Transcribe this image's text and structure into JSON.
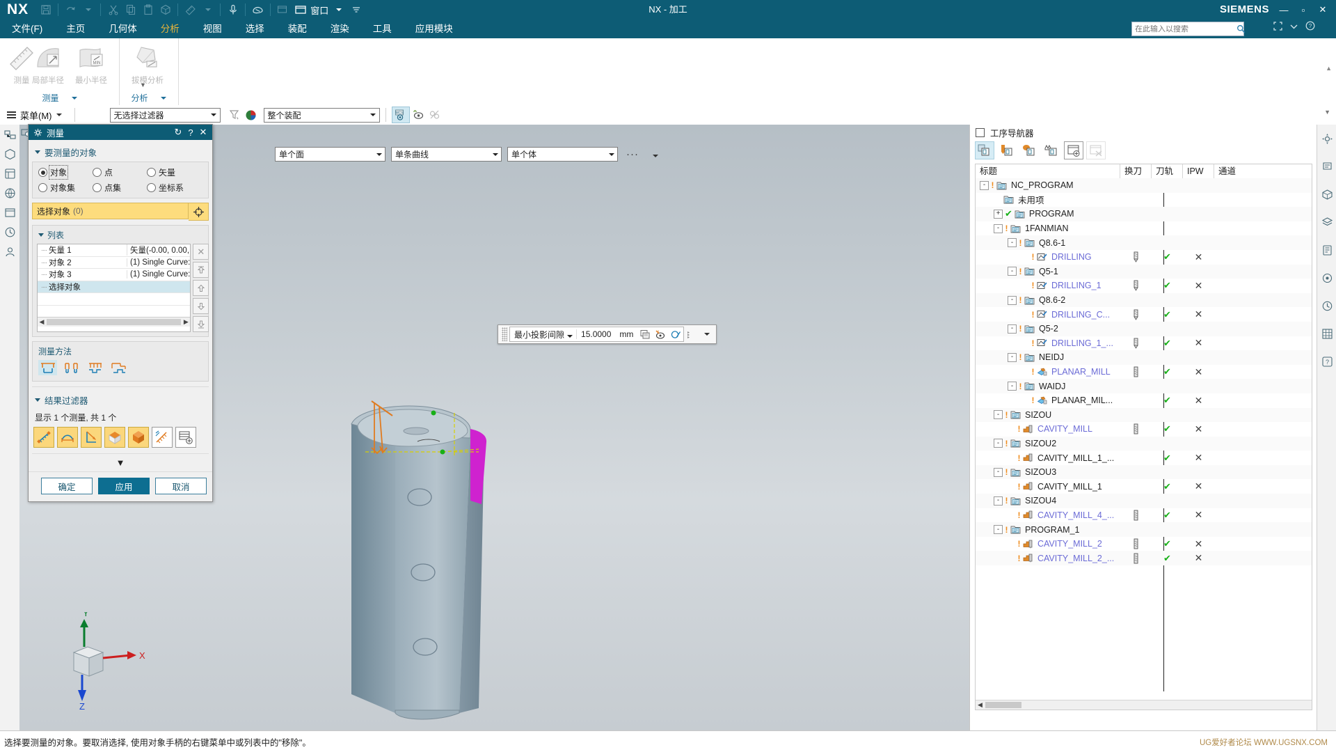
{
  "titlebar": {
    "logo": "NX",
    "window_title": "NX - 加工",
    "brand": "SIEMENS",
    "qat": [
      {
        "name": "save-icon",
        "label": "保存"
      },
      {
        "name": "undo-icon",
        "label": "撤销"
      },
      {
        "name": "undo-dropdown-icon",
        "label": "撤销下拉"
      },
      {
        "name": "cut-icon",
        "label": "剪切"
      },
      {
        "name": "copy-icon",
        "label": "复制"
      },
      {
        "name": "paste-icon",
        "label": "粘贴"
      },
      {
        "name": "paste-special-icon",
        "label": "选择性粘贴"
      },
      {
        "name": "measure-icon",
        "label": "测量"
      },
      {
        "name": "measure-dropdown-icon",
        "label": "测量下拉"
      },
      {
        "name": "microphone-icon",
        "label": "语音"
      },
      {
        "name": "eraser-icon",
        "label": "橡皮"
      },
      {
        "name": "window-list-icon",
        "label": "窗口列表"
      }
    ],
    "window_menu": "窗口",
    "win_buttons": [
      "—",
      "▫",
      "✕"
    ]
  },
  "ribbon": {
    "tabs": [
      {
        "label": "文件(F)",
        "active": false
      },
      {
        "label": "主页",
        "active": false
      },
      {
        "label": "几何体",
        "active": false
      },
      {
        "label": "分析",
        "active": true
      },
      {
        "label": "视图",
        "active": false
      },
      {
        "label": "选择",
        "active": false
      },
      {
        "label": "装配",
        "active": false
      },
      {
        "label": "渲染",
        "active": false
      },
      {
        "label": "工具",
        "active": false
      },
      {
        "label": "应用模块",
        "active": false
      }
    ],
    "search_placeholder": "在此输入以搜索",
    "groups": [
      {
        "label": "测量",
        "buttons": [
          {
            "label": "测量",
            "icon": "ruler-icon"
          },
          {
            "label": "局部半径",
            "icon": "local-radius-icon"
          },
          {
            "label": "最小半径",
            "icon": "min-radius-icon"
          }
        ]
      },
      {
        "label": "分析",
        "buttons": [
          {
            "label": "拔模分析",
            "icon": "draft-analysis-icon"
          }
        ]
      }
    ]
  },
  "selection_bar": {
    "menu_label": "菜单(M)",
    "filter_value": "无选择过滤器",
    "scope_value": "整个装配",
    "icons": [
      {
        "name": "selection-filter-icon",
        "active": false
      },
      {
        "name": "color-wheel-icon",
        "active": false
      },
      {
        "name": "wcs-display-icon",
        "active": true
      },
      {
        "name": "show-hide-icon",
        "active": false
      },
      {
        "name": "hide-icon",
        "active": false
      }
    ]
  },
  "left_bar": {
    "find_command": "发现命令",
    "items": [
      "assembly-navigator-icon",
      "part-navigator-icon",
      "reuse-library-icon",
      "hd3d-icon",
      "web-browser-icon",
      "history-icon",
      "roles-icon"
    ]
  },
  "graphics": {
    "selector_1": "单个面",
    "selector_2": "单条曲线",
    "selector_3": "单个体",
    "overflow": "···",
    "measure_float": {
      "mode": "最小投影间隙",
      "value": "15.0000",
      "unit": "mm",
      "icons": [
        "copy-result-icon",
        "annotation-icon",
        "circle-slash-icon",
        "list-options-icon"
      ]
    },
    "triad": {
      "x": "X",
      "y": "Y",
      "z": "Z"
    }
  },
  "dialog": {
    "title": "测量",
    "titlebar_icons": [
      "gear-icon",
      "reset-icon",
      "help-icon",
      "close-icon"
    ],
    "section_objects": "要测量的对象",
    "radios": [
      {
        "label": "对象",
        "checked": true,
        "focused": true
      },
      {
        "label": "点",
        "checked": false,
        "focused": false
      },
      {
        "label": "矢量",
        "checked": false,
        "focused": false
      },
      {
        "label": "对象集",
        "checked": false,
        "focused": false
      },
      {
        "label": "点集",
        "checked": false,
        "focused": false
      },
      {
        "label": "坐标系",
        "checked": false,
        "focused": false
      }
    ],
    "select_object_label": "选择对象",
    "select_object_count": "(0)",
    "list_label": "列表",
    "list_rows": [
      {
        "name": "矢量 1",
        "value": "矢量(-0.00, 0.00,",
        "selected": false
      },
      {
        "name": "对象 2",
        "value": "(1) Single Curve:",
        "selected": false
      },
      {
        "name": "对象 3",
        "value": "(1) Single Curve:",
        "selected": false
      },
      {
        "name": "选择对象",
        "value": "",
        "selected": true
      },
      {
        "name": "",
        "value": "",
        "selected": false
      },
      {
        "name": "",
        "value": "",
        "selected": false
      }
    ],
    "list_side_buttons": [
      "delete-icon",
      "move-to-top-icon",
      "move-up-icon",
      "move-down-icon",
      "move-to-bottom-icon"
    ],
    "method_label": "测量方法",
    "method_icons": [
      "measure-outer-icon",
      "measure-inner-icon",
      "measure-comb-icon",
      "measure-step-icon"
    ],
    "results_filter_label": "结果过滤器",
    "results_count_text": "显示 1 个测量, 共 1 个",
    "filter_icons": [
      "distance-filter-icon",
      "arc-filter-icon",
      "angle-filter-icon",
      "face-filter-icon",
      "body-filter-icon",
      "ruler-filter-icon",
      "table-add-icon"
    ],
    "buttons": {
      "ok": "确定",
      "apply": "应用",
      "cancel": "取消"
    }
  },
  "navigator": {
    "title": "工序导航器",
    "toolbar": [
      {
        "name": "program-order-view-icon",
        "active": true,
        "dim": false
      },
      {
        "name": "machine-tool-view-icon",
        "active": false,
        "dim": false
      },
      {
        "name": "geometry-view-icon",
        "active": false,
        "dim": false
      },
      {
        "name": "machining-method-view-icon",
        "active": false,
        "dim": false
      },
      {
        "name": "create-window-icon",
        "active": false,
        "dim": false
      },
      {
        "name": "close-window-icon",
        "active": false,
        "dim": true
      }
    ],
    "columns": [
      "标题",
      "换刀",
      "刀轨",
      "IPW",
      "通道"
    ],
    "rows": [
      {
        "name": "NC_PROGRAM",
        "indent": 0,
        "expander": "-",
        "bang": true,
        "check": false,
        "icon": "folder-icon",
        "blue": false,
        "tool": "",
        "path": "",
        "ipw": ""
      },
      {
        "name": "未用项",
        "indent": 1,
        "expander": "",
        "bang": false,
        "check": false,
        "icon": "folder-icon",
        "blue": false,
        "tool": "",
        "path": "",
        "ipw": ""
      },
      {
        "name": "PROGRAM",
        "indent": 1,
        "expander": "+",
        "bang": false,
        "check": true,
        "icon": "folder-icon",
        "blue": false,
        "tool": "",
        "path": "",
        "ipw": ""
      },
      {
        "name": "1FANMIAN",
        "indent": 1,
        "expander": "-",
        "bang": true,
        "check": false,
        "icon": "folder-icon",
        "blue": false,
        "tool": "",
        "path": "",
        "ipw": ""
      },
      {
        "name": "Q8.6-1",
        "indent": 2,
        "expander": "-",
        "bang": true,
        "check": false,
        "icon": "folder-icon",
        "blue": false,
        "tool": "",
        "path": "",
        "ipw": ""
      },
      {
        "name": "DRILLING",
        "indent": 3,
        "expander": "",
        "bang": true,
        "check": false,
        "icon": "drill-op-icon",
        "blue": true,
        "tool": "drill-tool-icon",
        "path": "check",
        "ipw": "x"
      },
      {
        "name": "Q5-1",
        "indent": 2,
        "expander": "-",
        "bang": true,
        "check": false,
        "icon": "folder-icon",
        "blue": false,
        "tool": "",
        "path": "",
        "ipw": ""
      },
      {
        "name": "DRILLING_1",
        "indent": 3,
        "expander": "",
        "bang": true,
        "check": false,
        "icon": "drill-op-icon",
        "blue": true,
        "tool": "drill-tool-icon",
        "path": "check",
        "ipw": "x"
      },
      {
        "name": "Q8.6-2",
        "indent": 2,
        "expander": "-",
        "bang": true,
        "check": false,
        "icon": "folder-icon",
        "blue": false,
        "tool": "",
        "path": "",
        "ipw": ""
      },
      {
        "name": "DRILLING_C...",
        "indent": 3,
        "expander": "",
        "bang": true,
        "check": false,
        "icon": "drill-op-icon",
        "blue": true,
        "tool": "drill-tool-icon",
        "path": "check",
        "ipw": "x"
      },
      {
        "name": "Q5-2",
        "indent": 2,
        "expander": "-",
        "bang": true,
        "check": false,
        "icon": "folder-icon",
        "blue": false,
        "tool": "",
        "path": "",
        "ipw": ""
      },
      {
        "name": "DRILLING_1_...",
        "indent": 3,
        "expander": "",
        "bang": true,
        "check": false,
        "icon": "drill-op-icon",
        "blue": true,
        "tool": "drill-tool-icon",
        "path": "check",
        "ipw": "x"
      },
      {
        "name": "NEIDJ",
        "indent": 2,
        "expander": "-",
        "bang": true,
        "check": false,
        "icon": "folder-icon",
        "blue": false,
        "tool": "",
        "path": "",
        "ipw": ""
      },
      {
        "name": "PLANAR_MILL",
        "indent": 3,
        "expander": "",
        "bang": true,
        "check": false,
        "icon": "planar-mill-icon",
        "blue": true,
        "tool": "mill-tool-icon",
        "path": "check",
        "ipw": "x"
      },
      {
        "name": "WAIDJ",
        "indent": 2,
        "expander": "-",
        "bang": true,
        "check": false,
        "icon": "folder-icon",
        "blue": false,
        "tool": "",
        "path": "",
        "ipw": ""
      },
      {
        "name": "PLANAR_MIL...",
        "indent": 3,
        "expander": "",
        "bang": true,
        "check": false,
        "icon": "planar-mill-icon",
        "blue": false,
        "tool": "",
        "path": "check",
        "ipw": "x"
      },
      {
        "name": "SIZOU",
        "indent": 1,
        "expander": "-",
        "bang": true,
        "check": false,
        "icon": "folder-icon",
        "blue": false,
        "tool": "",
        "path": "",
        "ipw": ""
      },
      {
        "name": "CAVITY_MILL",
        "indent": 2,
        "expander": "",
        "bang": true,
        "check": false,
        "icon": "cavity-mill-icon",
        "blue": true,
        "tool": "mill-tool-icon",
        "path": "check",
        "ipw": "x"
      },
      {
        "name": "SIZOU2",
        "indent": 1,
        "expander": "-",
        "bang": true,
        "check": false,
        "icon": "folder-icon",
        "blue": false,
        "tool": "",
        "path": "",
        "ipw": ""
      },
      {
        "name": "CAVITY_MILL_1_...",
        "indent": 2,
        "expander": "",
        "bang": true,
        "check": false,
        "icon": "cavity-mill-icon",
        "blue": false,
        "tool": "",
        "path": "check",
        "ipw": "x"
      },
      {
        "name": "SIZOU3",
        "indent": 1,
        "expander": "-",
        "bang": true,
        "check": false,
        "icon": "folder-icon",
        "blue": false,
        "tool": "",
        "path": "",
        "ipw": ""
      },
      {
        "name": "CAVITY_MILL_1",
        "indent": 2,
        "expander": "",
        "bang": true,
        "check": false,
        "icon": "cavity-mill-icon",
        "blue": false,
        "tool": "",
        "path": "check",
        "ipw": "x"
      },
      {
        "name": "SIZOU4",
        "indent": 1,
        "expander": "-",
        "bang": true,
        "check": false,
        "icon": "folder-icon",
        "blue": false,
        "tool": "",
        "path": "",
        "ipw": ""
      },
      {
        "name": "CAVITY_MILL_4_...",
        "indent": 2,
        "expander": "",
        "bang": true,
        "check": false,
        "icon": "cavity-mill-icon",
        "blue": true,
        "tool": "mill-tool-icon",
        "path": "check",
        "ipw": "x"
      },
      {
        "name": "PROGRAM_1",
        "indent": 1,
        "expander": "-",
        "bang": true,
        "check": false,
        "icon": "folder-icon",
        "blue": false,
        "tool": "",
        "path": "",
        "ipw": ""
      },
      {
        "name": "CAVITY_MILL_2",
        "indent": 2,
        "expander": "",
        "bang": true,
        "check": false,
        "icon": "cavity-mill-icon",
        "blue": true,
        "tool": "mill-tool-icon",
        "path": "check",
        "ipw": "x"
      },
      {
        "name": "CAVITY_MILL_2_...",
        "indent": 2,
        "expander": "",
        "bang": true,
        "check": false,
        "icon": "cavity-mill-icon",
        "blue": true,
        "tool": "mill-tool-icon",
        "path": "check",
        "ipw": "x"
      }
    ]
  },
  "right_bar": {
    "items": [
      "settings-icon",
      "search-panel-icon",
      "part-panel-icon",
      "layer-icon",
      "tool-panel-icon",
      "view-panel-icon",
      "history-panel-icon",
      "grid-panel-icon",
      "help-panel-icon"
    ]
  },
  "statusbar": {
    "message": "选择要测量的对象。要取消选择, 使用对象手柄的右键菜单中或列表中的\"移除\"。"
  },
  "watermark": "UG爱好者论坛  WWW.UGSNX.COM",
  "colors": {
    "brand_teal": "#0d5c75",
    "accent_gold": "#e8b53c",
    "yellow_field": "#fddc7d",
    "select_blue": "#cfe6ee",
    "check_green": "#18b018",
    "tree_link_blue": "#6b6bd6",
    "bang_orange": "#ef8b1b"
  }
}
